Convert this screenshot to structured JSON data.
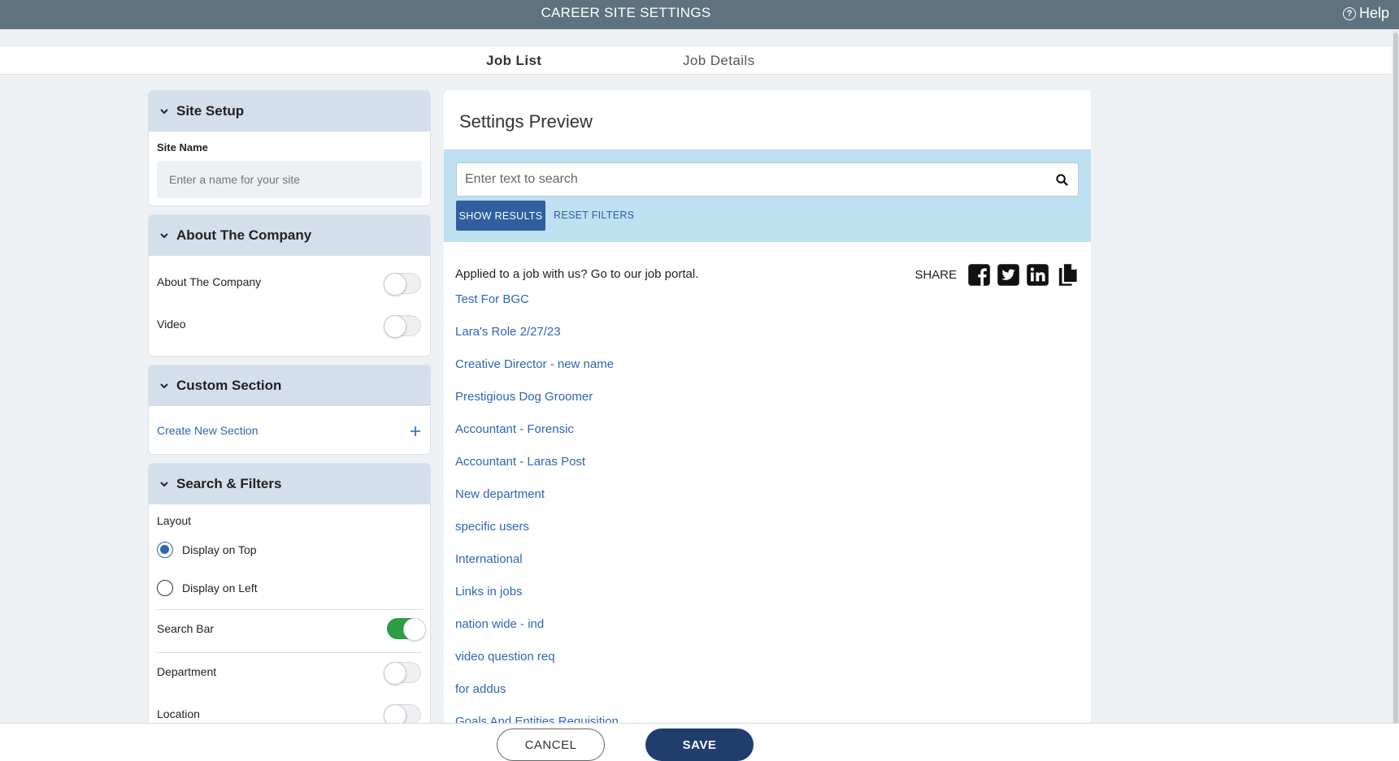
{
  "header": {
    "title": "CAREER SITE SETTINGS",
    "help_label": "Help"
  },
  "tabs": [
    {
      "label": "Job List",
      "active": true
    },
    {
      "label": "Job Details",
      "active": false
    }
  ],
  "site_setup": {
    "title": "Site Setup",
    "site_name_label": "Site Name",
    "site_name_placeholder": "Enter a name for your site",
    "site_name_value": ""
  },
  "about_company": {
    "title": "About The Company",
    "items": [
      {
        "label": "About The Company",
        "on": false
      },
      {
        "label": "Video",
        "on": false
      }
    ]
  },
  "custom_section": {
    "title": "Custom Section",
    "create_label": "Create New Section",
    "add_icon": "plus-icon"
  },
  "search_filters": {
    "title": "Search & Filters",
    "layout_label": "Layout",
    "layout_options": [
      {
        "label": "Display on Top",
        "selected": true
      },
      {
        "label": "Display on Left",
        "selected": false
      }
    ],
    "toggles": [
      {
        "label": "Search Bar",
        "on": true
      },
      {
        "label": "Department",
        "on": false
      },
      {
        "label": "Location",
        "on": false
      }
    ]
  },
  "preview": {
    "title": "Settings Preview",
    "search_placeholder": "Enter text to search",
    "show_results_label": "SHOW RESULTS",
    "reset_filters_label": "RESET FILTERS",
    "portal_text": "Applied to a job with us? Go to our job portal.",
    "share_label": "SHARE",
    "share_icons": [
      "facebook-icon",
      "twitter-icon",
      "linkedin-icon",
      "copy-icon"
    ],
    "jobs": [
      "Test For BGC",
      "Lara's Role 2/27/23",
      "Creative Director - new name",
      "Prestigious Dog Groomer",
      "Accountant - Forensic",
      "Accountant - Laras Post",
      "New department",
      "specific users",
      "International",
      "Links in jobs",
      "nation wide - ind",
      "video question req",
      "for addus",
      "Goals And Entities Requisition"
    ]
  },
  "footer": {
    "cancel_label": "CANCEL",
    "save_label": "SAVE"
  },
  "colors": {
    "header_bg": "#5f737e",
    "panel_head_bg": "#d4dfec",
    "link": "#2f66b3",
    "search_band": "#bee0f1",
    "primary_button": "#2f5f9e",
    "save_button": "#1f3d6d",
    "toggle_on": "#2e9e46"
  }
}
